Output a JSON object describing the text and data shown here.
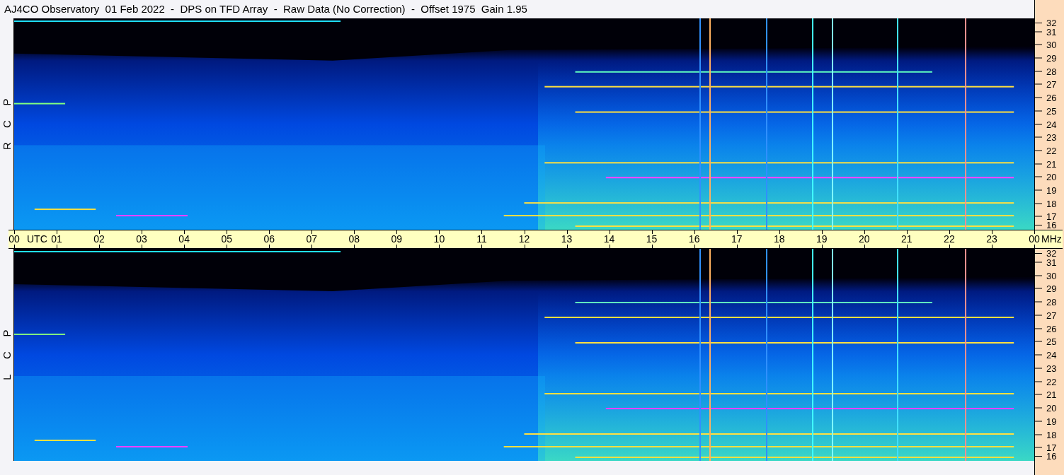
{
  "title": "AJ4CO Observatory  01 Feb 2022  -  DPS on TFD Array  -  Raw Data (No Correction)  -  Offset 1975  Gain 1.95",
  "panels": [
    {
      "polarization": [
        "R",
        "C",
        "P"
      ],
      "frequency_ticks": [
        "32",
        "31",
        "30",
        "29",
        "28",
        "27",
        "26",
        "25",
        "24",
        "23",
        "22",
        "21",
        "20",
        "19",
        "18",
        "17",
        "16"
      ]
    },
    {
      "polarization": [
        "L",
        "C",
        "P"
      ],
      "frequency_ticks": [
        "32",
        "31",
        "30",
        "29",
        "28",
        "27",
        "26",
        "25",
        "24",
        "23",
        "22",
        "21",
        "20",
        "19",
        "18",
        "17",
        "16"
      ]
    }
  ],
  "time_axis": {
    "ticks": [
      "00",
      "01",
      "02",
      "03",
      "04",
      "05",
      "06",
      "07",
      "08",
      "09",
      "10",
      "11",
      "12",
      "13",
      "14",
      "15",
      "16",
      "17",
      "18",
      "19",
      "20",
      "21",
      "22",
      "23",
      "00"
    ],
    "zone": "UTC",
    "unit": "MHz"
  }
}
